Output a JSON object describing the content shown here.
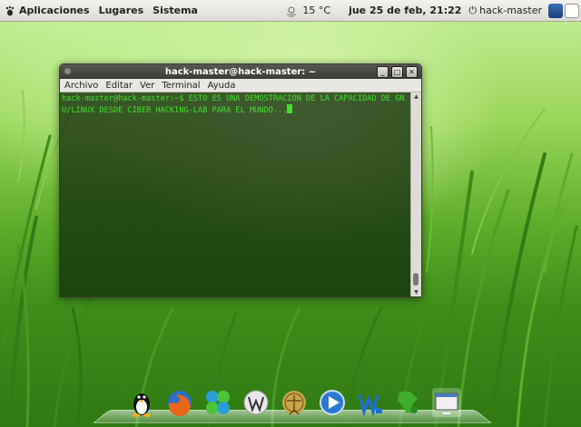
{
  "top_panel": {
    "menus": [
      "Aplicaciones",
      "Lugares",
      "Sistema"
    ],
    "weather_temp": "15 °C",
    "datetime": "jue 25 de feb, 21:22",
    "username": "hack-master"
  },
  "window": {
    "title": "hack-master@hack-master: ~",
    "menu": [
      "Archivo",
      "Editar",
      "Ver",
      "Terminal",
      "Ayuda"
    ],
    "terminal_text": "hack-master@hack-master:~$ ESTO ES UNA DEMOSTRACION DE LA CAPACIDAD DE GNU/LINUX DESDE CIBER HACKING-LAB PARA EL MUNDO..."
  },
  "dock_icons": [
    "tux-icon",
    "firefox-icon",
    "pidgin-icon",
    "wikipedia-icon",
    "vitruvian-icon",
    "media-player-icon",
    "writer-icon",
    "inkscape-icon",
    "window-switcher-icon"
  ]
}
